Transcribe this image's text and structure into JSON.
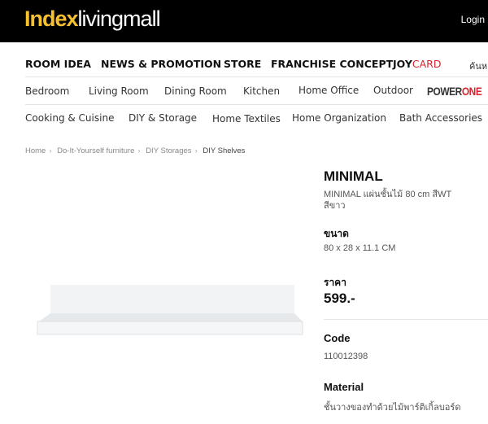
{
  "header": {
    "logo_bold": "Index",
    "logo_rest": "livingmall",
    "login": "Login"
  },
  "main_nav": [
    {
      "label": "ROOM IDEA"
    },
    {
      "label": "NEWS & PROMOTION"
    },
    {
      "label": "STORE"
    },
    {
      "label": "FRANCHISE CONCEPT"
    }
  ],
  "joycard": {
    "joy": "JOY",
    "card": "CARD"
  },
  "search_placeholder": "ค้นห",
  "category_nav": [
    "Bedroom",
    "Living Room",
    "Dining Room",
    "Kitchen",
    "Home Office",
    "Outdoor"
  ],
  "powerone": {
    "power": "POWER",
    "one": "ONE"
  },
  "category_nav2": [
    "Cooking & Cuisine",
    "DIY & Storage",
    "Home Textiles",
    "Home Organization",
    "Bath Accessories"
  ],
  "breadcrumb": [
    "Home",
    "Do-It-Yourself furniture",
    "DIY Storages",
    "DIY Shelves"
  ],
  "product": {
    "brand": "MINIMAL",
    "name": "MINIMAL แผ่นชั้นไม้ 80 cm สีWT",
    "color": "สีขาว",
    "size_label": "ขนาด",
    "size": "80 x 28 x 11.1 CM",
    "price_label": "ราคา",
    "price": "599.-",
    "code_label": "Code",
    "code": "110012398",
    "material_label": "Material",
    "material": "ชั้นวางของทำด้วยไม้พาร์ติเกิ้ลบอร์ด"
  },
  "colors": {
    "logo_yellow": "#f5c12e",
    "card_red": "#d7242f"
  }
}
